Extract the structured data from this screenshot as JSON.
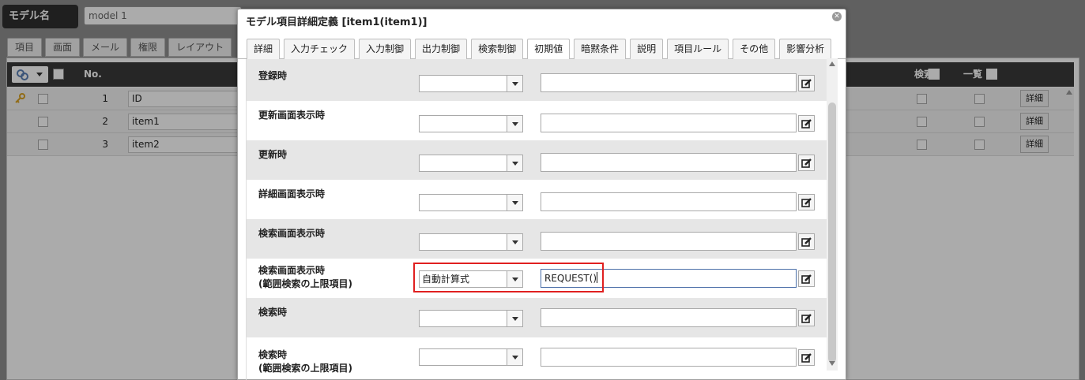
{
  "background": {
    "model_name_label": "モデル名",
    "model_name_value": "model 1",
    "tabs": [
      "項目",
      "画面",
      "メール",
      "権限",
      "レイアウト"
    ],
    "grid_header": {
      "no": "No.",
      "search": "検索",
      "list": "一覧"
    },
    "rows": [
      {
        "num": "1",
        "name": "ID",
        "detail": "詳細"
      },
      {
        "num": "2",
        "name": "item1",
        "detail": "詳細"
      },
      {
        "num": "3",
        "name": "item2",
        "detail": "詳細"
      }
    ]
  },
  "dialog": {
    "title": "モデル項目詳細定義 [item1(item1)]",
    "close_icon": "close-icon",
    "tabs": [
      {
        "label": "詳細",
        "active": false
      },
      {
        "label": "入力チェック",
        "active": false
      },
      {
        "label": "入力制御",
        "active": false
      },
      {
        "label": "出力制御",
        "active": false
      },
      {
        "label": "検索制御",
        "active": false
      },
      {
        "label": "初期値",
        "active": true
      },
      {
        "label": "暗黙条件",
        "active": false
      },
      {
        "label": "説明",
        "active": false
      },
      {
        "label": "項目ルール",
        "active": false
      },
      {
        "label": "その他",
        "active": false
      },
      {
        "label": "影響分析",
        "active": false
      }
    ],
    "fields": [
      {
        "label_line1": "登録時",
        "label_line2": "",
        "select": "",
        "value": ""
      },
      {
        "label_line1": "更新画面表示時",
        "label_line2": "",
        "select": "",
        "value": ""
      },
      {
        "label_line1": "更新時",
        "label_line2": "",
        "select": "",
        "value": ""
      },
      {
        "label_line1": "詳細画面表示時",
        "label_line2": "",
        "select": "",
        "value": ""
      },
      {
        "label_line1": "検索画面表示時",
        "label_line2": "",
        "select": "",
        "value": ""
      },
      {
        "label_line1": "検索画面表示時",
        "label_line2": "(範囲検索の上限項目)",
        "select": "自動計算式",
        "value": "REQUEST()"
      },
      {
        "label_line1": "検索時",
        "label_line2": "",
        "select": "",
        "value": ""
      },
      {
        "label_line1": "検索時",
        "label_line2": "(範囲検索の上限項目)",
        "select": "",
        "value": ""
      }
    ]
  },
  "colors": {
    "highlight": "#e02020",
    "header_dark": "#3a3a3a"
  }
}
